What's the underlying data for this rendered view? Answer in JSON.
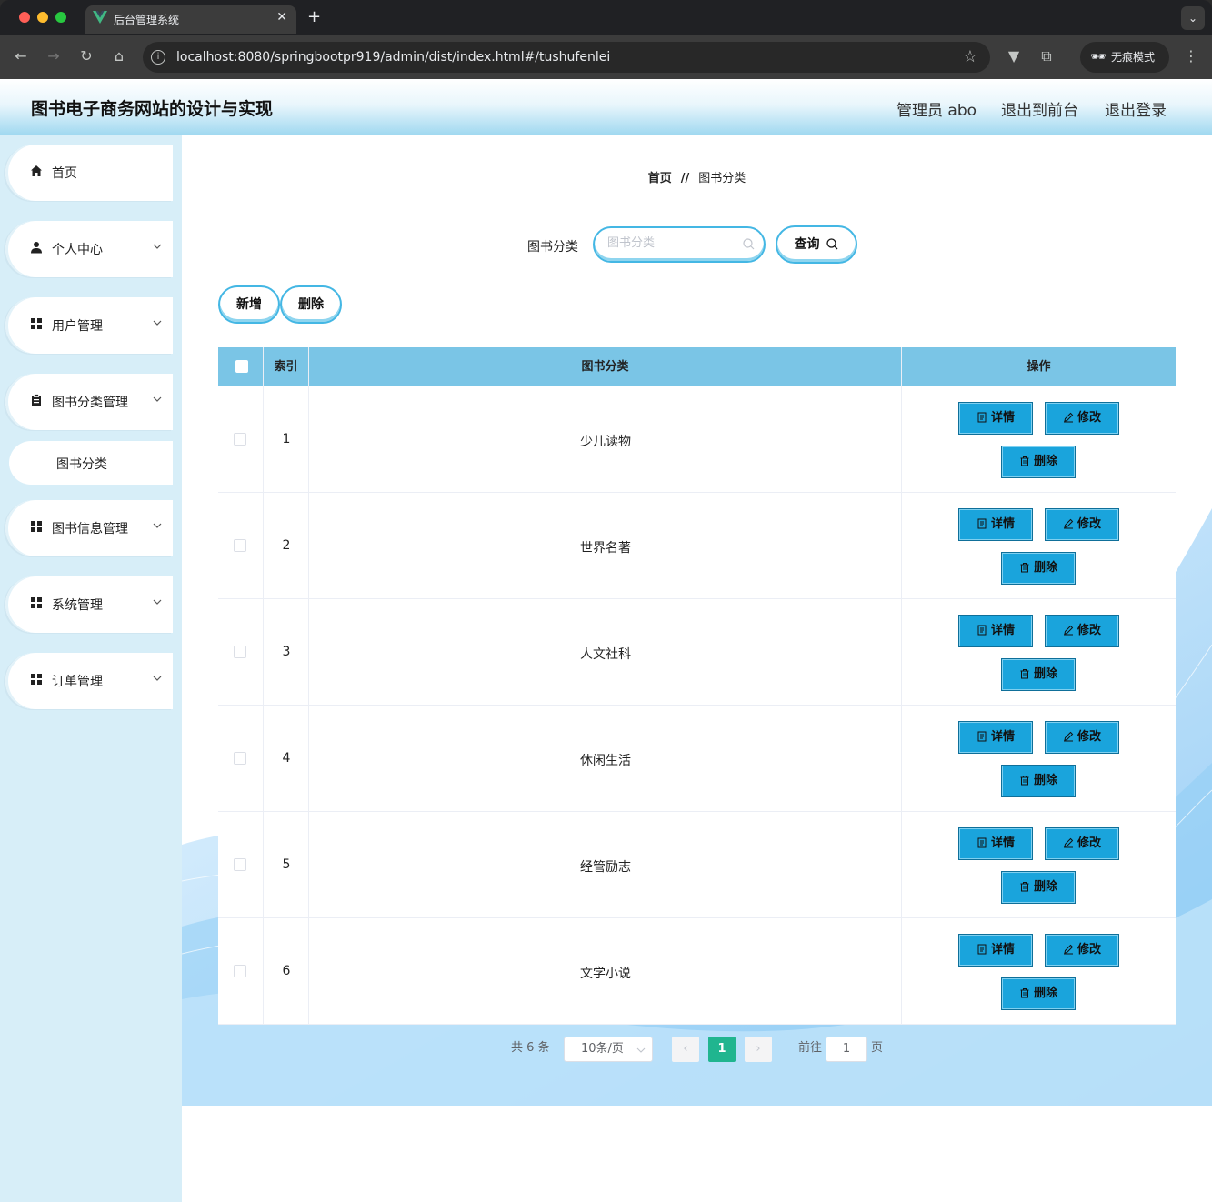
{
  "browser": {
    "tab_title": "后台管理系统",
    "url": "localhost:8080/springbootpr919/admin/dist/index.html#/tushufenlei",
    "incognito_label": "无痕模式"
  },
  "header": {
    "title": "图书电子商务网站的设计与实现",
    "user": "管理员 abo",
    "to_front": "退出到前台",
    "logout": "退出登录"
  },
  "sidebar": {
    "items": [
      {
        "label": "首页",
        "icon": "home-icon"
      },
      {
        "label": "个人中心",
        "icon": "user-icon"
      },
      {
        "label": "用户管理",
        "icon": "grid-icon"
      },
      {
        "label": "图书分类管理",
        "icon": "clipboard-icon"
      },
      {
        "label": "图书信息管理",
        "icon": "grid-icon"
      },
      {
        "label": "系统管理",
        "icon": "grid-icon"
      },
      {
        "label": "订单管理",
        "icon": "grid-icon"
      }
    ],
    "subitem": "图书分类"
  },
  "breadcrumb": {
    "home": "首页",
    "separator": "//",
    "current": "图书分类"
  },
  "search": {
    "label": "图书分类",
    "placeholder": "图书分类",
    "button": "查询"
  },
  "actions": {
    "add": "新增",
    "delete": "删除"
  },
  "table": {
    "columns": [
      "索引",
      "图书分类",
      "操作"
    ],
    "rows": [
      {
        "index": "1",
        "category": "少儿读物"
      },
      {
        "index": "2",
        "category": "世界名著"
      },
      {
        "index": "3",
        "category": "人文社科"
      },
      {
        "index": "4",
        "category": "休闲生活"
      },
      {
        "index": "5",
        "category": "经管励志"
      },
      {
        "index": "6",
        "category": "文学小说"
      }
    ],
    "ops": {
      "detail": "详情",
      "edit": "修改",
      "delete": "删除"
    }
  },
  "pagination": {
    "total": "共 6 条",
    "page_size": "10条/页",
    "current": "1",
    "goto_label": "前往",
    "goto_value": "1",
    "page_suffix": "页"
  },
  "colors": {
    "accent": "#1aa4dc",
    "header_bg": "#7ac5e6",
    "sidebar_bg": "#d7eef8",
    "pager_active": "#20b58f"
  }
}
